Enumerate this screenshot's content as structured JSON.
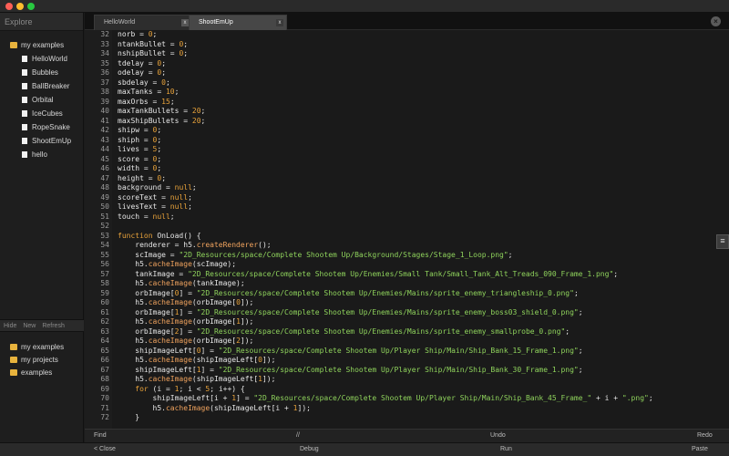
{
  "window": {
    "controls": [
      "close",
      "minimize",
      "zoom"
    ]
  },
  "sidebar": {
    "header": "Explore",
    "root_label": "my examples",
    "items": [
      "HelloWorld",
      "Bubbles",
      "BallBreaker",
      "Orbital",
      "IceCubes",
      "RopeSnake",
      "ShootEmUp",
      "hello"
    ],
    "actions": {
      "hide": "Hide",
      "new": "New",
      "refresh": "Refresh"
    },
    "lower_items": [
      "my examples",
      "my projects",
      "examples"
    ]
  },
  "tabs": [
    {
      "label": "HelloWorld",
      "active": false
    },
    {
      "label": "ShootEmUp",
      "active": true
    }
  ],
  "editor": {
    "line_numbers": [
      "32",
      "33",
      "34",
      "35",
      "36",
      "37",
      "38",
      "39",
      "40",
      "41",
      "42",
      "43",
      "44",
      "45",
      "46",
      "47",
      "48",
      "49",
      "50",
      "51",
      "52",
      "53",
      "54",
      "55",
      "56",
      "57",
      "58",
      "59",
      "60",
      "61",
      "62",
      "63",
      "64",
      "65",
      "66",
      "67",
      "68",
      "69",
      "70",
      "71",
      "72"
    ],
    "lines": [
      "norb = 0;",
      "ntankBullet = 0;",
      "nshipBullet = 0;",
      "tdelay = 0;",
      "odelay = 0;",
      "sbdelay = 0;",
      "maxTanks = 10;",
      "maxOrbs = 15;",
      "maxTankBullets = 20;",
      "maxShipBullets = 20;",
      "shipw = 0;",
      "shiph = 0;",
      "lives = 5;",
      "score = 0;",
      "width = 0;",
      "height = 0;",
      "background = null;",
      "scoreText = null;",
      "livesText = null;",
      "touch = null;",
      "",
      "function OnLoad() {",
      "    renderer = h5.createRenderer();",
      "    scImage = \"2D_Resources/space/Complete Shootem Up/Background/Stages/Stage_1_Loop.png\";",
      "    h5.cacheImage(scImage);",
      "    tankImage = \"2D_Resources/space/Complete Shootem Up/Enemies/Small Tank/Small_Tank_Alt_Treads_090_Frame_1.png\";",
      "    h5.cacheImage(tankImage);",
      "    orbImage[0] = \"2D_Resources/space/Complete Shootem Up/Enemies/Mains/sprite_enemy_triangleship_0.png\";",
      "    h5.cacheImage(orbImage[0]);",
      "    orbImage[1] = \"2D_Resources/space/Complete Shootem Up/Enemies/Mains/sprite_enemy_boss03_shield_0.png\";",
      "    h5.cacheImage(orbImage[1]);",
      "    orbImage[2] = \"2D_Resources/space/Complete Shootem Up/Enemies/Mains/sprite_enemy_smallprobe_0.png\";",
      "    h5.cacheImage(orbImage[2]);",
      "    shipImageLeft[0] = \"2D_Resources/space/Complete Shootem Up/Player Ship/Main/Ship_Bank_15_Frame_1.png\";",
      "    h5.cacheImage(shipImageLeft[0]);",
      "    shipImageLeft[1] = \"2D_Resources/space/Complete Shootem Up/Player Ship/Main/Ship_Bank_30_Frame_1.png\";",
      "    h5.cacheImage(shipImageLeft[1]);",
      "    for (i = 1; i < 5; i++) {",
      "        shipImageLeft[i + 1] = \"2D_Resources/space/Complete Shootem Up/Player Ship/Main/Ship_Bank_45_Frame_\" + i + \".png\";",
      "        h5.cacheImage(shipImageLeft[i + 1]);",
      "    }"
    ]
  },
  "toolbar1": {
    "find": "Find",
    "comment": "//",
    "undo": "Undo",
    "redo": "Redo"
  },
  "toolbar2": {
    "close": "< Close",
    "debug": "Debug",
    "run": "Run",
    "paste": "Paste"
  },
  "colors": {
    "folder": "#e8b33d",
    "keyword": "#e8a23a",
    "number": "#e8a23a",
    "string": "#8fd35c",
    "method": "#f0a35e"
  }
}
